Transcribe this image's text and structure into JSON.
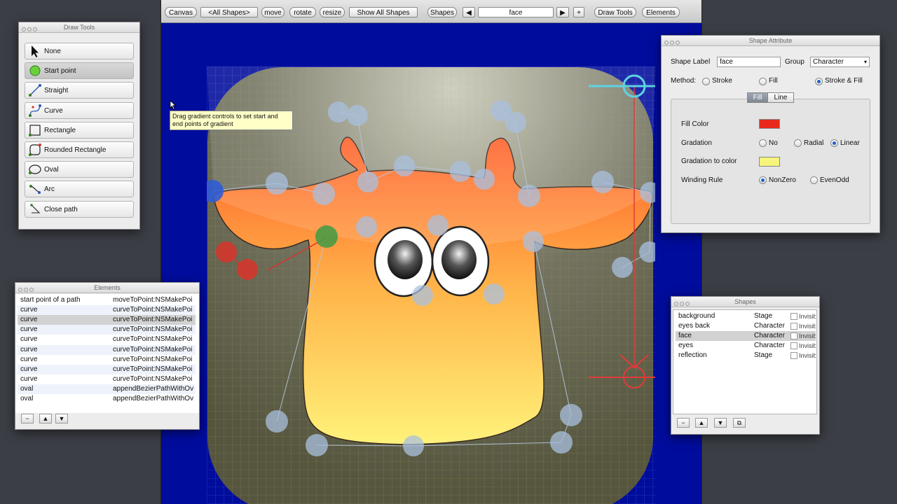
{
  "toolbar": {
    "canvas": "Canvas",
    "all_shapes": "<All Shapes>",
    "move": "move",
    "rotate": "rotate",
    "resize": "resize",
    "show_all_shapes": "Show All Shapes",
    "shapes": "Shapes",
    "prev": "◀",
    "shape_name": "face",
    "next": "▶",
    "add": "+",
    "draw_tools": "Draw Tools",
    "elements": "Elements"
  },
  "tooltip": "Drag gradient controls to set start and end points of gradient",
  "draw_tools": {
    "title": "Draw Tools",
    "items": [
      {
        "label": "None",
        "icon": "arrow-cursor-icon"
      },
      {
        "label": "Start point",
        "icon": "start-point-icon",
        "selected": true
      },
      {
        "label": "Straight",
        "icon": "straight-line-icon"
      },
      {
        "label": "Curve",
        "icon": "curve-icon"
      },
      {
        "label": "Rectangle",
        "icon": "rectangle-icon"
      },
      {
        "label": "Rounded Rectangle",
        "icon": "rounded-rectangle-icon"
      },
      {
        "label": "Oval",
        "icon": "oval-icon"
      },
      {
        "label": "Arc",
        "icon": "arc-icon"
      },
      {
        "label": "Close path",
        "icon": "close-path-icon"
      }
    ]
  },
  "elements": {
    "title": "Elements",
    "rows": [
      {
        "type": "start point of a path",
        "code": "moveToPoint:NSMakePoi"
      },
      {
        "type": "curve",
        "code": "curveToPoint:NSMakePoi"
      },
      {
        "type": "curve",
        "code": "curveToPoint:NSMakePoi",
        "selected": true
      },
      {
        "type": "curve",
        "code": "curveToPoint:NSMakePoi"
      },
      {
        "type": "curve",
        "code": "curveToPoint:NSMakePoi"
      },
      {
        "type": "curve",
        "code": "curveToPoint:NSMakePoi"
      },
      {
        "type": "curve",
        "code": "curveToPoint:NSMakePoi"
      },
      {
        "type": "curve",
        "code": "curveToPoint:NSMakePoi"
      },
      {
        "type": "curve",
        "code": "curveToPoint:NSMakePoi"
      },
      {
        "type": "oval",
        "code": "appendBezierPathWithOv"
      },
      {
        "type": "oval",
        "code": "appendBezierPathWithOv"
      }
    ],
    "buttons": {
      "remove": "−",
      "up": "▲",
      "down": "▼"
    }
  },
  "shape_attribute": {
    "title": "Shape Attribute",
    "shape_label": "Shape Label",
    "shape_label_value": "face",
    "group_label": "Group",
    "group_value": "Character",
    "method_label": "Method:",
    "method_options": [
      "Stroke",
      "Fill",
      "Stroke & Fill"
    ],
    "method_selected": "Stroke & Fill",
    "tabs": [
      "Fill",
      "Line"
    ],
    "tab_selected": "Fill",
    "fill_color_label": "Fill Color",
    "fill_color": "#e8281c",
    "gradation_label": "Gradation",
    "gradation_options": [
      "No",
      "Radial",
      "Linear"
    ],
    "gradation_selected": "Linear",
    "gradation_to_label": "Gradation to color",
    "gradation_to_color": "#f6f47a",
    "winding_label": "Winding Rule",
    "winding_options": [
      "NonZero",
      "EvenOdd"
    ],
    "winding_selected": "NonZero"
  },
  "shapes": {
    "title": "Shapes",
    "rows": [
      {
        "name": "background",
        "group": "Stage",
        "invisible": "Invisible"
      },
      {
        "name": "eyes back",
        "group": "Character",
        "invisible": "Invisible"
      },
      {
        "name": "face",
        "group": "Character",
        "invisible": "Invisible",
        "selected": true
      },
      {
        "name": "eyes",
        "group": "Character",
        "invisible": "Invisible"
      },
      {
        "name": "reflection",
        "group": "Stage",
        "invisible": "Invisible"
      }
    ],
    "buttons": {
      "remove": "−",
      "up": "▲",
      "down": "▼",
      "duplicate": "⧉"
    }
  },
  "colors": {
    "canvas_background": "#000c9c",
    "face_top": "#ff7a2e",
    "face_bottom": "#fff27a",
    "handle_blue": "#a9c0df",
    "handle_red": "#d9342a",
    "handle_green": "#4b9a45",
    "gradient_start_marker": "#5ed3e3",
    "gradient_end_marker": "#e23a3a"
  }
}
